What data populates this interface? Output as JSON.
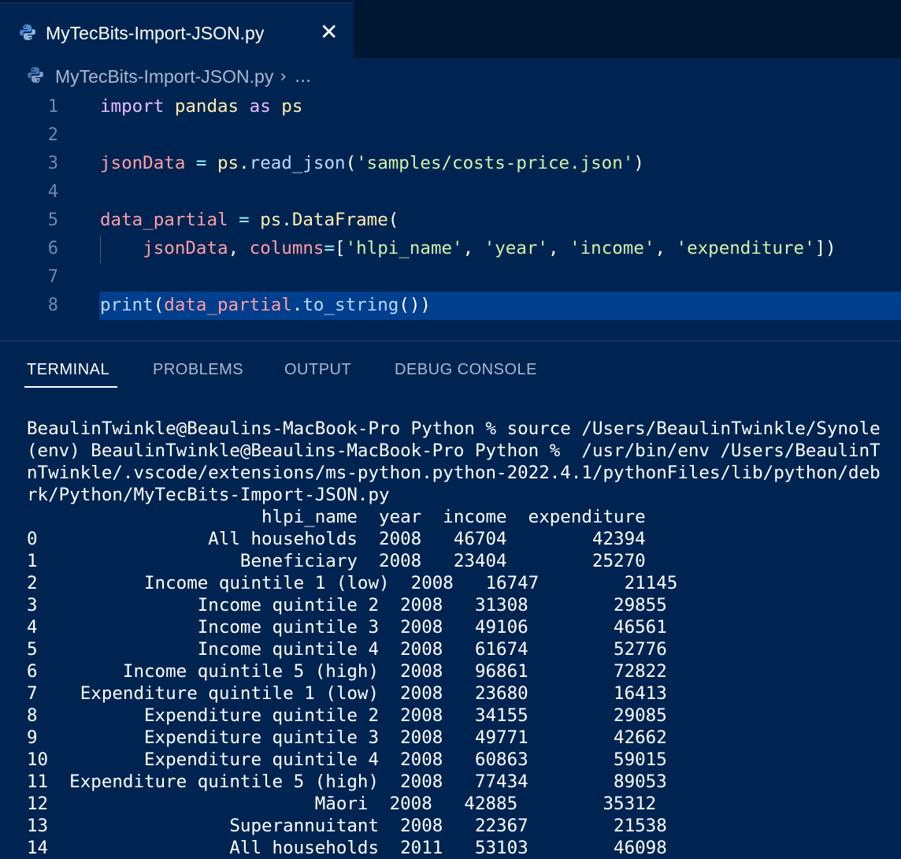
{
  "tab": {
    "title": "MyTecBits-Import-JSON.py",
    "close_glyph": "✕"
  },
  "breadcrumb": {
    "file": "MyTecBits-Import-JSON.py",
    "sep": "›",
    "more": "..."
  },
  "editor": {
    "line_numbers": [
      "1",
      "2",
      "3",
      "4",
      "5",
      "6",
      "7",
      "8"
    ],
    "active_line": 8
  },
  "panel": {
    "tabs": [
      {
        "label": "TERMINAL",
        "active": true
      },
      {
        "label": "PROBLEMS",
        "active": false
      },
      {
        "label": "OUTPUT",
        "active": false
      },
      {
        "label": "DEBUG CONSOLE",
        "active": false
      }
    ]
  },
  "terminal": {
    "lines": [
      "BeaulinTwinkle@Beaulins-MacBook-Pro Python % source /Users/BeaulinTwinkle/Synole",
      "(env) BeaulinTwinkle@Beaulins-MacBook-Pro Python %  /usr/bin/env /Users/BeaulinT",
      "nTwinkle/.vscode/extensions/ms-python.python-2022.4.1/pythonFiles/lib/python/deb",
      "rk/Python/MyTecBits-Import-JSON.py",
      "                      hlpi_name  year  income  expenditure",
      "0                All households  2008   46704        42394",
      "1                   Beneficiary  2008   23404        25270",
      "2          Income quintile 1 (low)  2008   16747        21145",
      "3               Income quintile 2  2008   31308        29855",
      "4               Income quintile 3  2008   49106        46561",
      "5               Income quintile 4  2008   61674        52776",
      "6        Income quintile 5 (high)  2008   96861        72822",
      "7    Expenditure quintile 1 (low)  2008   23680        16413",
      "8          Expenditure quintile 2  2008   34155        29085",
      "9          Expenditure quintile 3  2008   49771        42662",
      "10         Expenditure quintile 4  2008   60863        59015",
      "11  Expenditure quintile 5 (high)  2008   77434        89053",
      "12                         Māori  2008   42885        35312",
      "13                 Superannuitant  2008   22367        21538",
      "14                 All households  2011   53103        46098"
    ]
  }
}
